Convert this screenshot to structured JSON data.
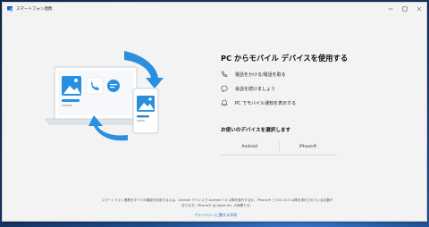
{
  "window": {
    "title": "スマートフォン連携"
  },
  "colors": {
    "accent": "#1a61c9",
    "window_bg": "#f3f3f3"
  },
  "main": {
    "heading": "PC からモバイル デバイスを使用する",
    "features": [
      {
        "icon": "phone-icon",
        "text": "電話をかける/電話を取る"
      },
      {
        "icon": "chat-icon",
        "text": "会話を続けましょう"
      },
      {
        "icon": "bell-icon",
        "text": "PC でモバイル通知を表示する"
      }
    ],
    "choose_label": "お使いのデバイスを選択します",
    "devices": {
      "android": "Android",
      "iphone": "iPhone®"
    }
  },
  "footer": {
    "notice": "スマートフォン連携をすべての機能を利用するには、Android デバイスで Android 7.0 以降を実行するか、iPhone® で iOS 14.0 以降を実行されている必要があります。iPhone® は Apple Inc. の商標です。",
    "privacy_link": "プライバシーに関する声明"
  }
}
